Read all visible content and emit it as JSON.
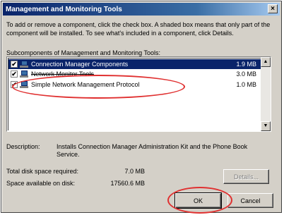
{
  "window": {
    "title": "Management and Monitoring Tools",
    "close_glyph": "×"
  },
  "instructions": "To add or remove a component, click the check box. A shaded box means that only part of the component will be installed. To see what's included in a component, click Details.",
  "subcomponents_label": "Subcomponents of Management and Monitoring Tools:",
  "components": [
    {
      "name": "Connection Manager Components",
      "size": "1.9 MB",
      "checked": true,
      "selected": true
    },
    {
      "name": "Network Monitor Tools",
      "size": "3.0 MB",
      "checked": true,
      "selected": false
    },
    {
      "name": "Simple Network Management Protocol",
      "size": "1.0 MB",
      "checked": true,
      "selected": false
    }
  ],
  "description": {
    "label": "Description:",
    "text": "Installs Connection Manager Administration Kit and the Phone Book Service."
  },
  "disk": {
    "total_label": "Total disk space required:",
    "total_value": "7.0 MB",
    "available_label": "Space available on disk:",
    "available_value": "17560.6 MB"
  },
  "buttons": {
    "details": "Details...",
    "ok": "OK",
    "cancel": "Cancel"
  },
  "colors": {
    "selection": "#0a246a",
    "annotation": "#e03030"
  }
}
